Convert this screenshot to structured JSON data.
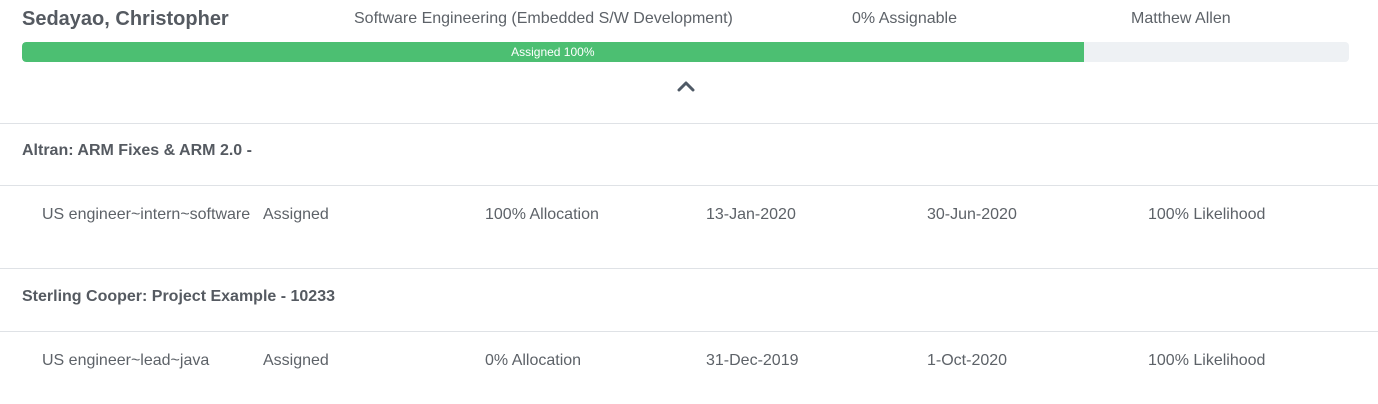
{
  "person": {
    "name": "Sedayao, Christopher",
    "discipline": "Software Engineering (Embedded S/W Development)",
    "assignable": "0% Assignable",
    "manager": "Matthew Allen"
  },
  "assignment_bar": {
    "label": "Assigned 100%",
    "fill_fraction": 0.8,
    "fill_color": "#4cbf72",
    "track_color": "#eef1f4"
  },
  "toggle": {
    "icon": "chevron-up-icon"
  },
  "projects": [
    {
      "title": "Altran: ARM Fixes & ARM 2.0 -",
      "assignment": {
        "role": "US engineer~intern~software",
        "status": "Assigned",
        "allocation": "100% Allocation",
        "start_date": "13-Jan-2020",
        "end_date": "30-Jun-2020",
        "likelihood": "100% Likelihood"
      }
    },
    {
      "title": "Sterling Cooper: Project Example - 10233",
      "assignment": {
        "role": "US engineer~lead~java",
        "status": "Assigned",
        "allocation": "0% Allocation",
        "start_date": "31-Dec-2019",
        "end_date": "1-Oct-2020",
        "likelihood": "100% Likelihood"
      }
    }
  ]
}
